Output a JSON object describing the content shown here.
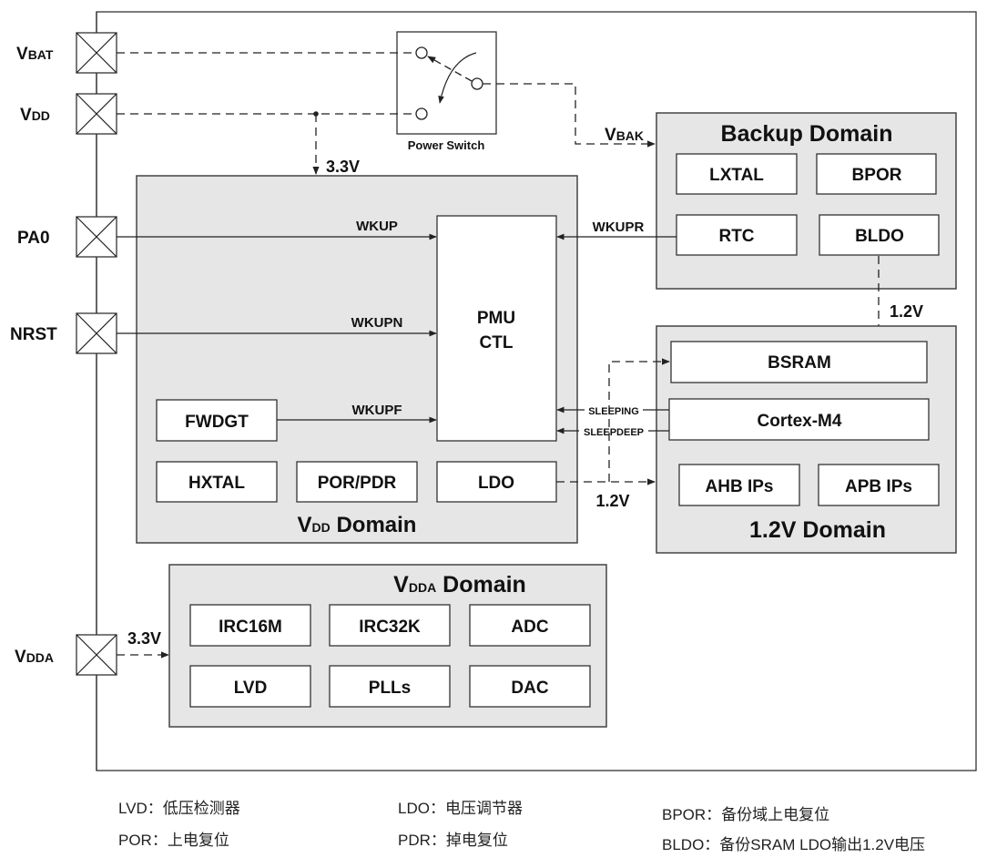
{
  "pins": {
    "vbat": {
      "main": "V",
      "sub": "BAT"
    },
    "vdd": {
      "main": "V",
      "sub": "DD"
    },
    "pa0": "PA0",
    "nrst": "NRST",
    "vdda": {
      "main": "V",
      "sub": "DDA"
    }
  },
  "power_switch": {
    "label": "Power Switch"
  },
  "voltages": {
    "vdd_33": "3.3V",
    "vbak": {
      "main": "V",
      "sub": "BAK"
    },
    "bldo_12": "1.2V",
    "ldo_12": "1.2V",
    "vdda_33": "3.3V"
  },
  "signals": {
    "wkup": "WKUP",
    "wkupn": "WKUPN",
    "wkupf": "WKUPF",
    "wkupr": "WKUPR",
    "sleeping": "SLEEPING",
    "sleepdeep": "SLEEPDEEP"
  },
  "vdd_domain": {
    "title_main": "V",
    "title_sub": "DD",
    "title_rest": " Domain",
    "pmu": [
      "PMU",
      "CTL"
    ],
    "blocks": {
      "fwdgt": "FWDGT",
      "hxtal": "HXTAL",
      "porpdr": "POR/PDR",
      "ldo": "LDO"
    }
  },
  "backup_domain": {
    "title": "Backup Domain",
    "blocks": {
      "lxtal": "LXTAL",
      "bpor": "BPOR",
      "rtc": "RTC",
      "bldo": "BLDO"
    }
  },
  "core_domain": {
    "title": "1.2V Domain",
    "blocks": {
      "bsram": "BSRAM",
      "cortex": "Cortex-M4",
      "ahb": "AHB IPs",
      "apb": "APB IPs"
    }
  },
  "vdda_domain": {
    "title_main": "V",
    "title_sub": "DDA",
    "title_rest": " Domain",
    "blocks": {
      "irc16m": "IRC16M",
      "irc32k": "IRC32K",
      "adc": "ADC",
      "lvd": "LVD",
      "plls": "PLLs",
      "dac": "DAC"
    }
  },
  "legend": {
    "lvd": "LVD：低压检测器",
    "por": "POR：上电复位",
    "ldo": "LDO：电压调节器",
    "pdr": "PDR：掉电复位",
    "bpor": "BPOR：备份域上电复位",
    "bldo": "BLDO：备份SRAM LDO输出1.2V电压"
  }
}
